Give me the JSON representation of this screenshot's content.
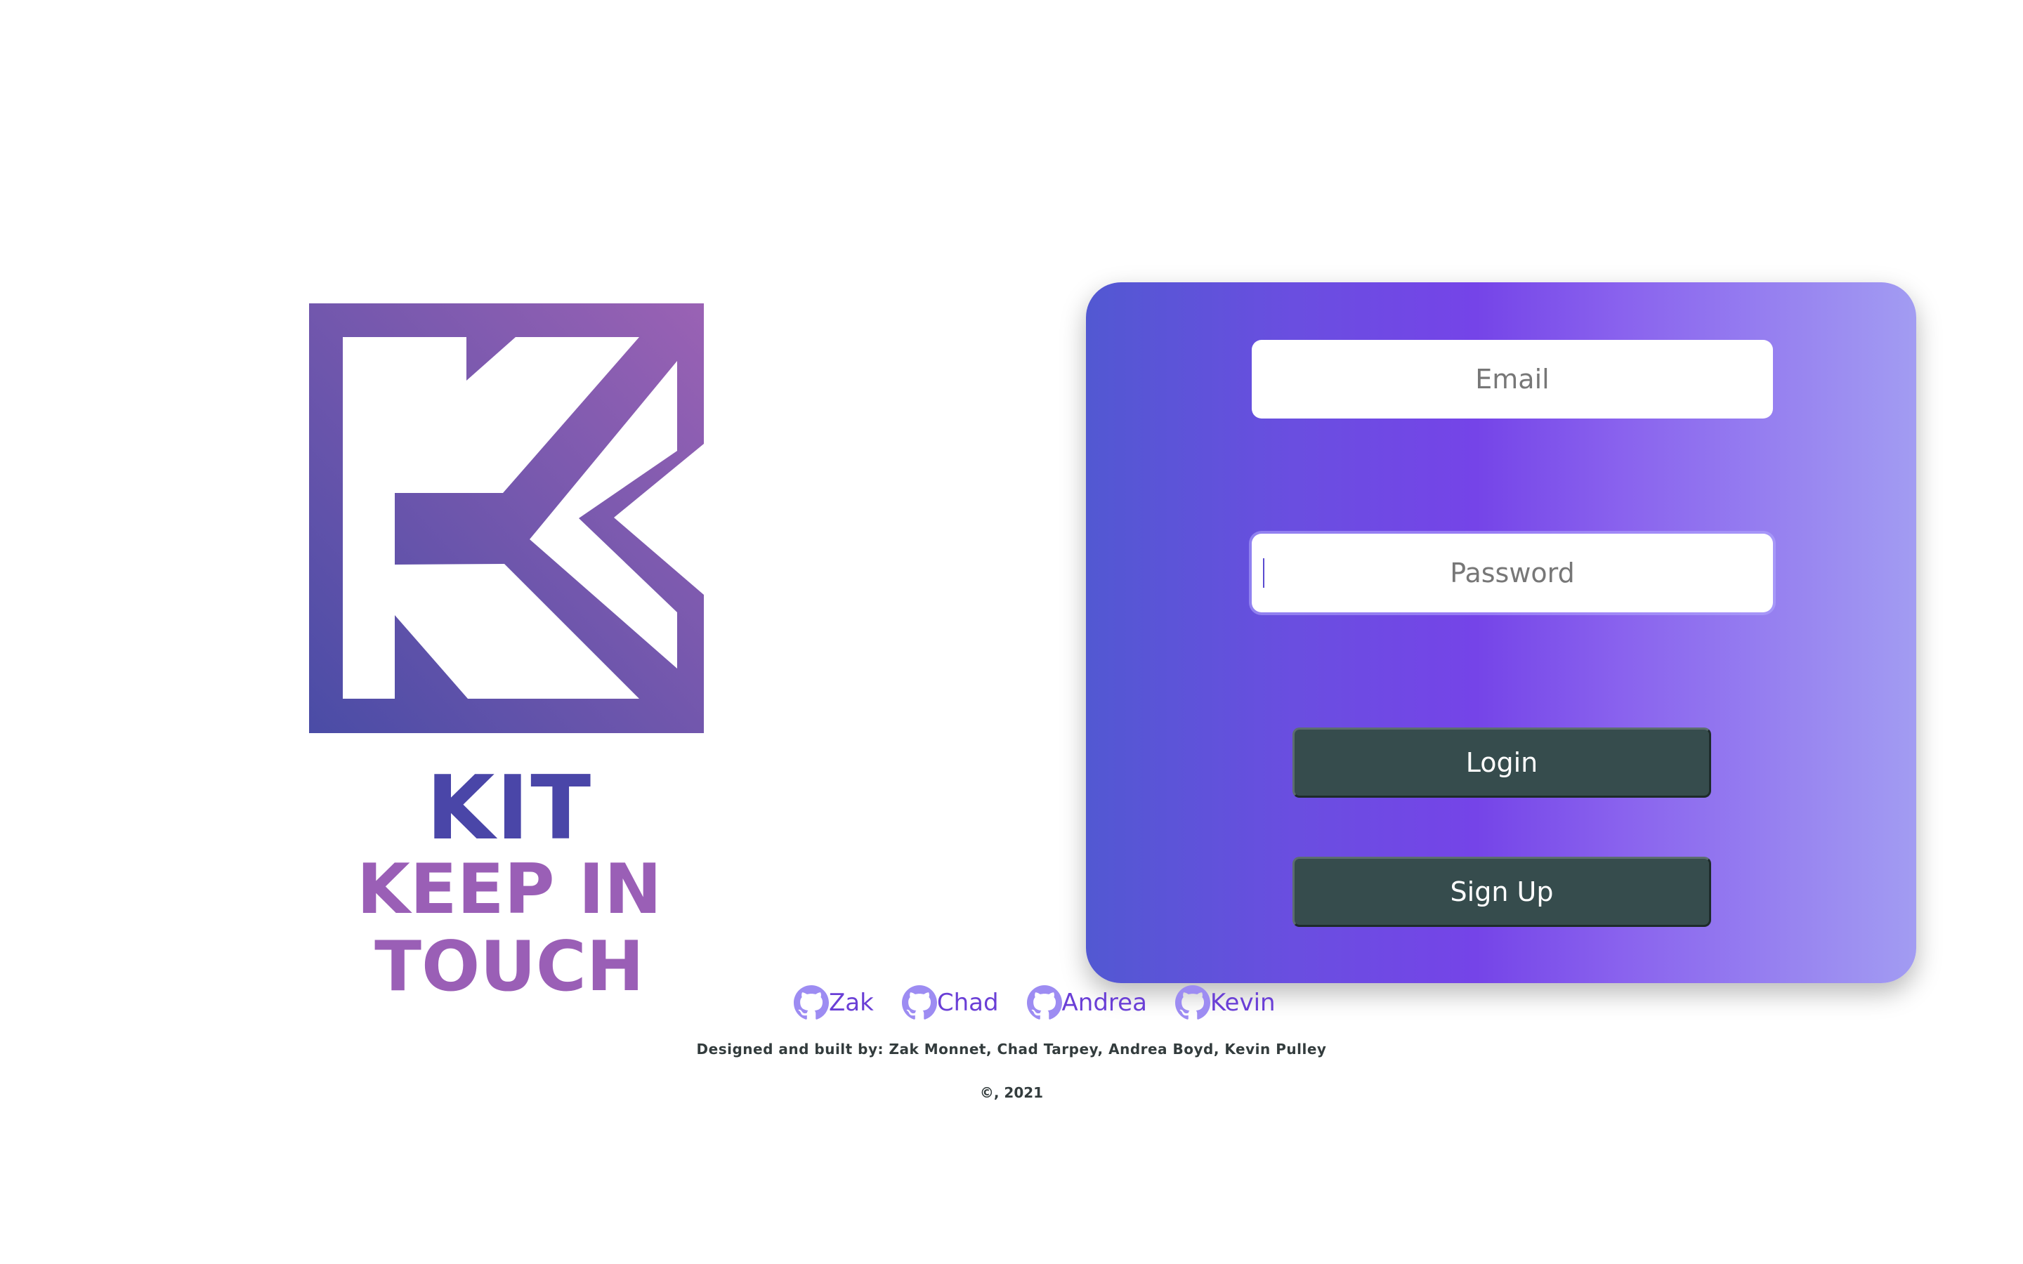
{
  "brand": {
    "name": "KIT",
    "tagline": "KEEP IN TOUCH",
    "logo_icon": "k-logo-icon",
    "colors": {
      "gradient_start": "#4a4ca6",
      "gradient_end": "#9a62b4",
      "name": "#4a46a8",
      "tagline": "#9a5fb6"
    }
  },
  "login_form": {
    "email": {
      "placeholder": "Email",
      "value": ""
    },
    "password": {
      "placeholder": "Password",
      "value": ""
    },
    "login_button": "Login",
    "signup_button": "Sign Up",
    "colors": {
      "card_gradient": [
        "#5258d2",
        "#7544e8",
        "#a29cf2"
      ],
      "button_bg": "#364c4d",
      "button_text": "#ffffff"
    }
  },
  "footer": {
    "developers": [
      {
        "name": "Zak",
        "icon": "github-icon"
      },
      {
        "name": "Chad",
        "icon": "github-icon"
      },
      {
        "name": "Andrea",
        "icon": "github-icon"
      },
      {
        "name": "Kevin",
        "icon": "github-icon"
      }
    ],
    "credits": "Designed and built by: Zak Monnet, Chad Tarpey, Andrea Boyd, Kevin Pulley",
    "copyright": "©, 2021",
    "link_color": "#6a3fd6"
  }
}
